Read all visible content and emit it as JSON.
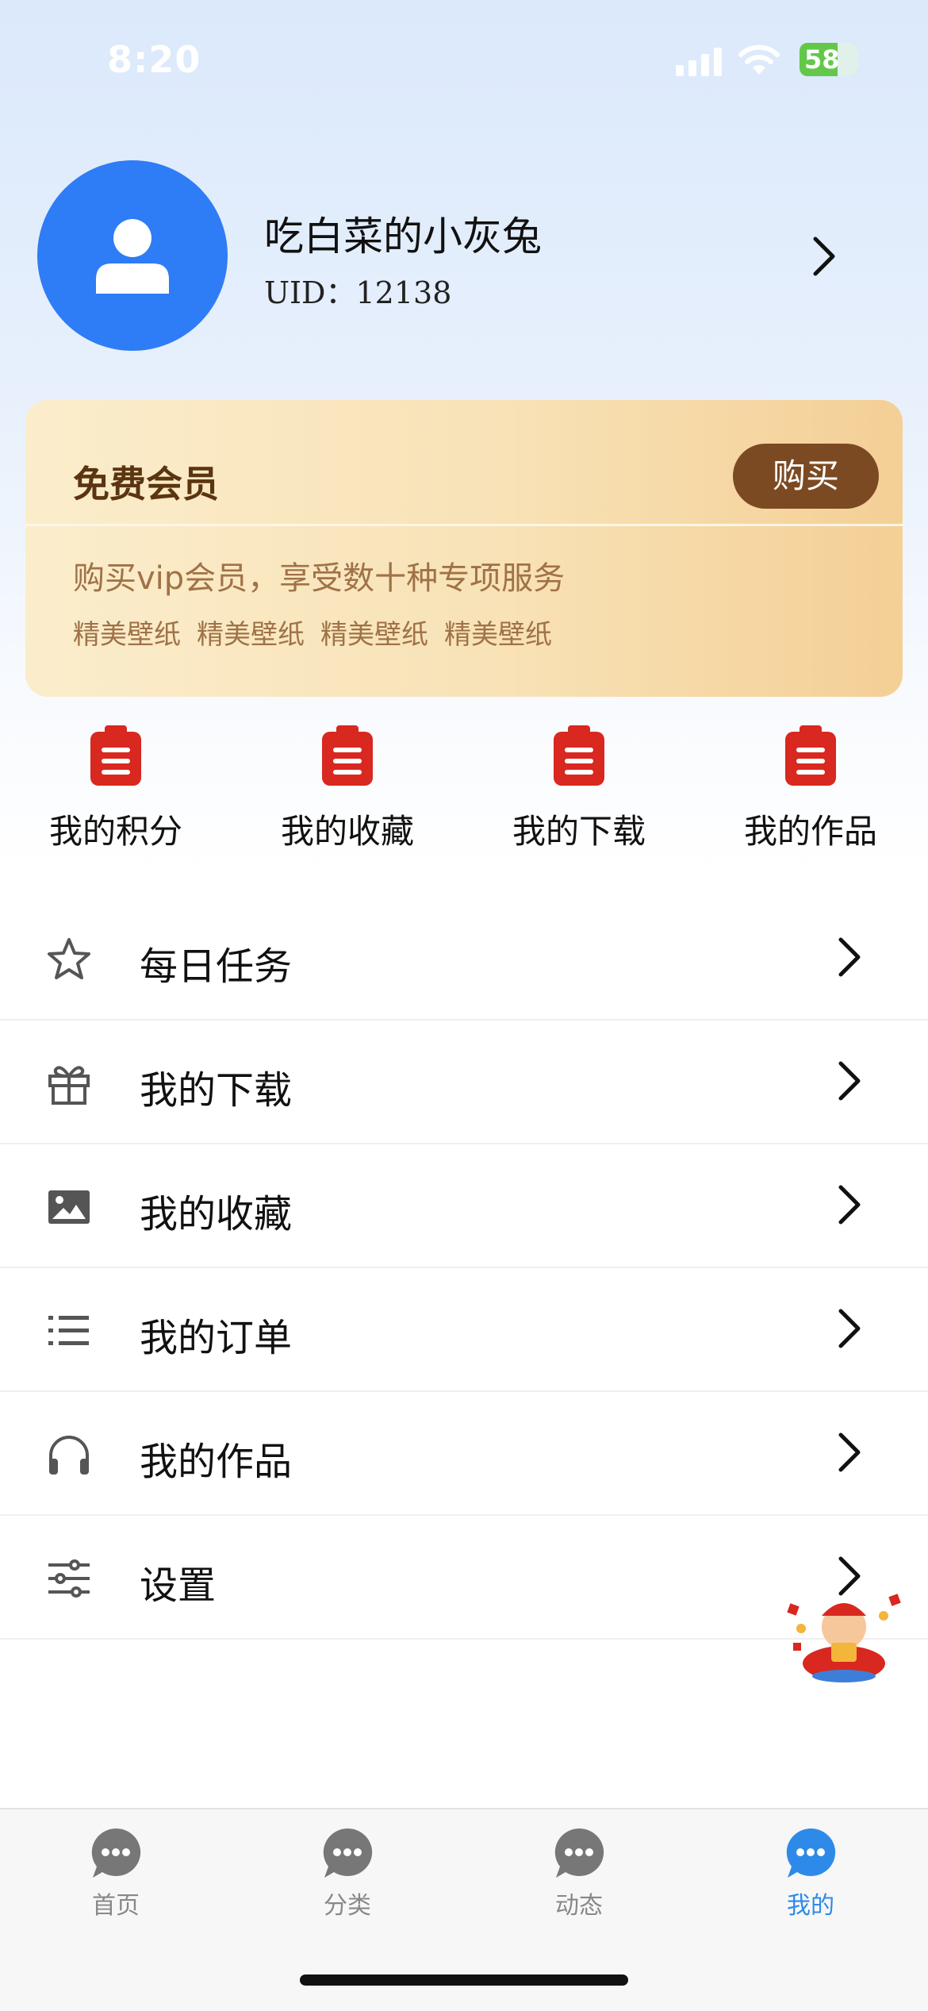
{
  "status_bar": {
    "time": "8:20",
    "battery": "58"
  },
  "profile": {
    "username": "吃白菜的小灰兔",
    "uid": "UID：12138"
  },
  "vip_card": {
    "title": "免费会员",
    "buy_label": "购买",
    "description": "购买vip会员，享受数十种专项服务",
    "tags": [
      "精美壁纸",
      "精美壁纸",
      "精美壁纸",
      "精美壁纸"
    ]
  },
  "quick_actions": [
    {
      "label": "我的积分",
      "icon": "clipboard-icon"
    },
    {
      "label": "我的收藏",
      "icon": "clipboard-icon"
    },
    {
      "label": "我的下载",
      "icon": "clipboard-icon"
    },
    {
      "label": "我的作品",
      "icon": "clipboard-icon"
    }
  ],
  "menu": [
    {
      "label": "每日任务",
      "icon": "star-icon"
    },
    {
      "label": "我的下载",
      "icon": "gift-icon"
    },
    {
      "label": "我的收藏",
      "icon": "image-icon"
    },
    {
      "label": "我的订单",
      "icon": "list-icon"
    },
    {
      "label": "我的作品",
      "icon": "headphones-icon"
    },
    {
      "label": "设置",
      "icon": "sliders-icon"
    }
  ],
  "tabbar": [
    {
      "label": "首页",
      "icon": "chat-bubble-icon"
    },
    {
      "label": "分类",
      "icon": "chat-bubble-icon"
    },
    {
      "label": "动态",
      "icon": "chat-bubble-icon"
    },
    {
      "label": "我的",
      "icon": "chat-bubble-icon",
      "active": true
    }
  ],
  "colors": {
    "accent": "#2e8ae8",
    "avatar": "#2e7cf6",
    "buy_button": "#7b4a22",
    "clipboard_red": "#d8281f",
    "tab_inactive": "#888888"
  }
}
